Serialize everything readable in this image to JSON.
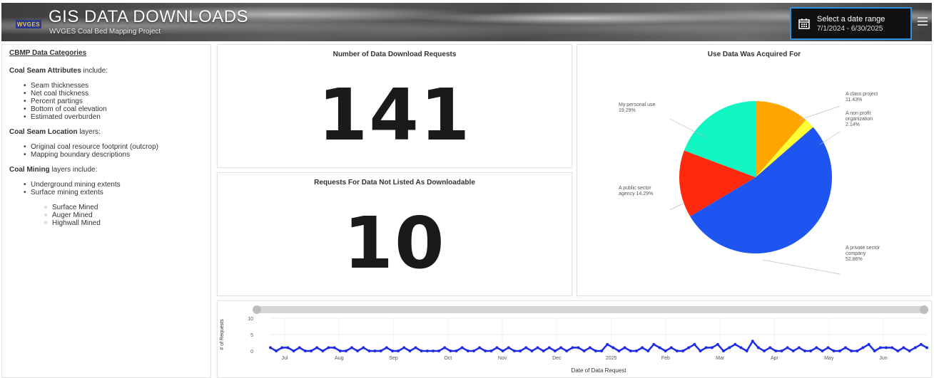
{
  "header": {
    "logo_text": "WVGES",
    "title": "GIS DATA DOWNLOADS",
    "subtitle": "WVGES Coal Bed Mapping Project",
    "date_picker_label": "Select a date range",
    "date_range": "7/1/2024 - 6/30/2025"
  },
  "sidebar": {
    "title": "CBMP Data Categories",
    "sections": [
      {
        "bold": "Coal Seam Attributes",
        "rest": " include:",
        "items": [
          "Seam thicknesses",
          "Net coal thickness",
          "Percent partings",
          "Bottom of coal elevation",
          "Estimated overburden"
        ]
      },
      {
        "bold": "Coal Seam Location",
        "rest": " layers:",
        "items": [
          "Original coal resource footprint (outcrop)",
          "Mapping boundary descriptions"
        ]
      },
      {
        "bold": "Coal Mining",
        "rest": " layers include:",
        "items": [
          "Underground mining extents",
          "Surface mining extents"
        ],
        "subitems": [
          "Surface Mined",
          "Auger Mined",
          "Highwall Mined"
        ]
      }
    ]
  },
  "cards": {
    "downloads_title": "Number of Data Download Requests",
    "downloads_value": "141",
    "not_listed_title": "Requests For Data Not Listed As Downloadable",
    "not_listed_value": "10",
    "pie_title": "Use Data Was Acquired For",
    "timeline_ylabel": "# of Requests",
    "timeline_xlabel": "Date of Data Request"
  },
  "pie_labels": {
    "class_project": [
      "A class project",
      "11.43%"
    ],
    "non_profit": [
      "A non profit",
      "organization",
      "2.14%"
    ],
    "personal": [
      "My personal use",
      "19.29%"
    ],
    "public": [
      "A public sector",
      "agency 14.29%"
    ],
    "private": [
      "A private sector",
      "company",
      "52.86%"
    ]
  },
  "colors": {
    "class_project": "#ffa500",
    "non_profit": "#ffff33",
    "private": "#1e55f0",
    "public": "#ff2a0d",
    "personal": "#11f5c2",
    "timeline": "#1f2ce8",
    "date_border": "#2f8fe0"
  },
  "chart_data": [
    {
      "type": "pie",
      "title": "Use Data Was Acquired For",
      "categories": [
        "A class project",
        "A non profit organization",
        "A private sector company",
        "A public sector agency",
        "My personal use"
      ],
      "values": [
        11.43,
        2.14,
        52.86,
        14.29,
        19.29
      ]
    },
    {
      "type": "line",
      "title": "",
      "xlabel": "Date of Data Request",
      "ylabel": "# of Requests",
      "ylim": [
        0,
        10
      ],
      "yticks": [
        "0",
        "5",
        "10"
      ],
      "x_tick_labels": [
        "Jul",
        "Aug",
        "Sep",
        "Oct",
        "Nov",
        "Dec",
        "2025",
        "Feb",
        "Mar",
        "Apr",
        "May",
        "Jun"
      ],
      "series": [
        {
          "values": [
            1,
            0,
            1,
            1,
            0,
            1,
            0,
            0,
            1,
            0,
            1,
            1,
            0,
            0,
            1,
            0,
            1,
            0,
            0,
            0,
            1,
            0,
            0,
            1,
            0,
            1,
            0,
            0,
            0,
            0,
            1,
            0,
            0,
            1,
            0,
            0,
            1,
            0,
            0,
            1,
            0,
            1,
            0,
            0,
            1,
            0,
            1,
            0,
            1,
            0,
            1,
            0,
            1,
            1,
            0,
            1,
            0,
            0,
            2,
            1,
            0,
            1,
            0,
            0,
            1,
            0,
            2,
            1,
            0,
            1,
            0,
            0,
            1,
            2,
            0,
            1,
            1,
            2,
            0,
            1,
            2,
            1,
            0,
            3,
            1,
            0,
            1,
            0,
            0,
            1,
            0,
            1,
            0,
            0,
            1,
            0,
            1,
            0,
            0,
            1,
            0,
            0,
            1,
            2,
            0,
            1,
            1,
            1,
            0,
            1,
            0,
            1,
            2,
            1
          ]
        }
      ]
    }
  ]
}
